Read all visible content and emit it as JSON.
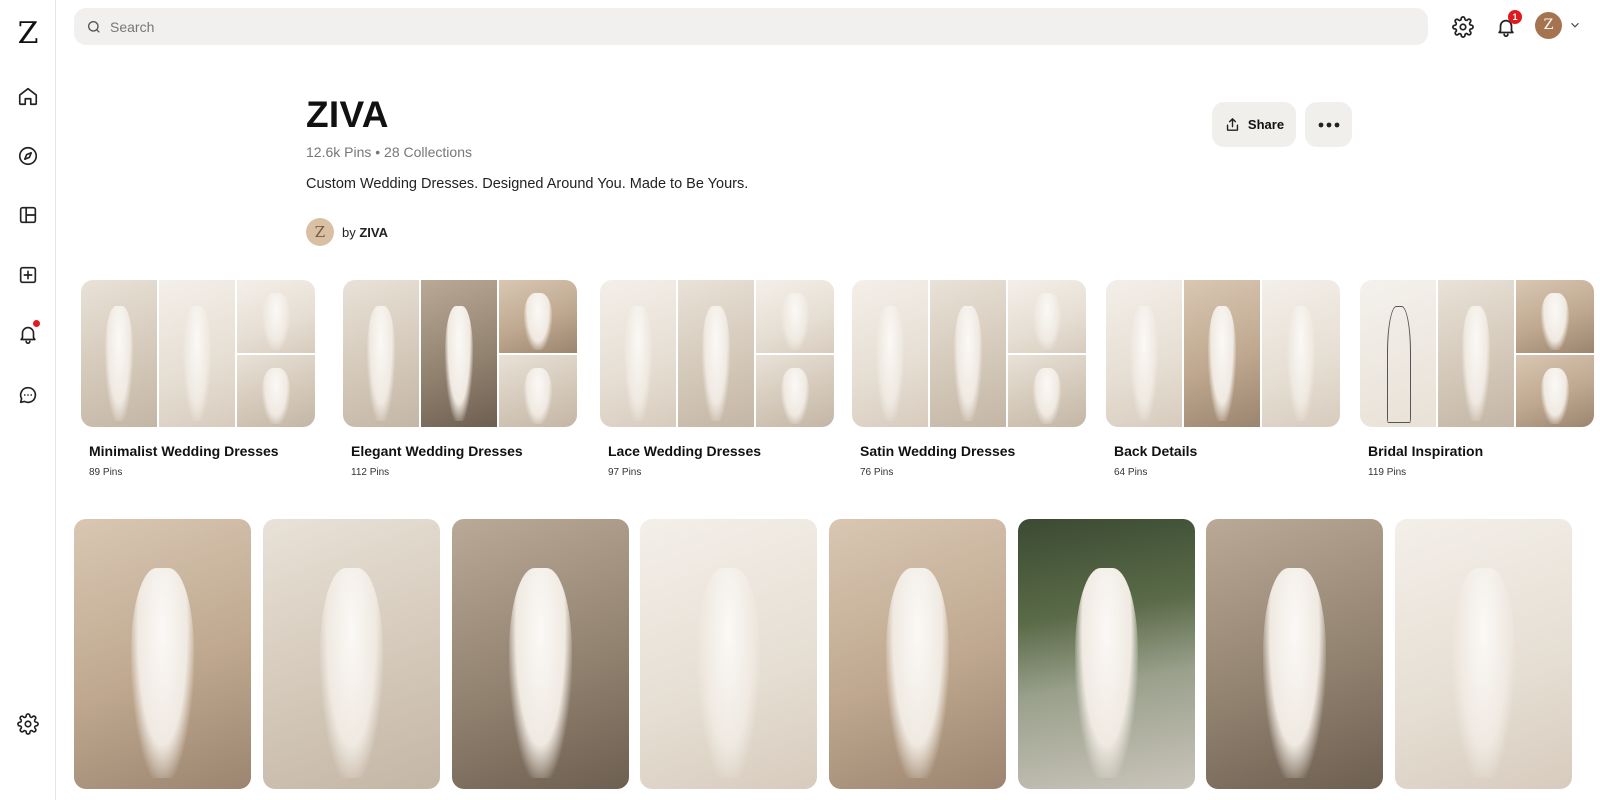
{
  "app": {
    "logo": "Z"
  },
  "search": {
    "placeholder": "Search"
  },
  "topbar": {
    "notification_count": "1",
    "avatar_initial": "Z"
  },
  "sidebar": {
    "items": [
      {
        "name": "home",
        "icon": "home-icon"
      },
      {
        "name": "explore",
        "icon": "compass-icon"
      },
      {
        "name": "boards",
        "icon": "layout-icon"
      },
      {
        "name": "create",
        "icon": "plus-square-icon"
      },
      {
        "name": "notifications",
        "icon": "bell-icon",
        "has_dot": true
      },
      {
        "name": "messages",
        "icon": "chat-icon"
      },
      {
        "name": "settings",
        "icon": "gear-icon"
      }
    ]
  },
  "profile": {
    "title": "ZIVA",
    "stats": "12.6k Pins • 28 Collections",
    "description": "Custom Wedding Dresses. Designed Around You. Made to Be Yours.",
    "avatar_initial": "Z",
    "by_label": "by",
    "by_name": "ZIVA",
    "share_label": "Share"
  },
  "collections": [
    {
      "name": "Minimalist Wedding Dresses",
      "count": "89 Pins"
    },
    {
      "name": "Elegant Wedding Dresses",
      "count": "112 Pins"
    },
    {
      "name": "Lace Wedding Dresses",
      "count": "97 Pins"
    },
    {
      "name": "Satin Wedding Dresses",
      "count": "76 Pins"
    },
    {
      "name": "Back Details",
      "count": "64 Pins"
    },
    {
      "name": "Bridal Inspiration",
      "count": "119 Pins"
    }
  ],
  "colors": {
    "accent_red": "#e0191f",
    "button_bg": "#f1efec",
    "search_bg": "#f1f0ee",
    "avatar_brown": "#a5734f"
  }
}
